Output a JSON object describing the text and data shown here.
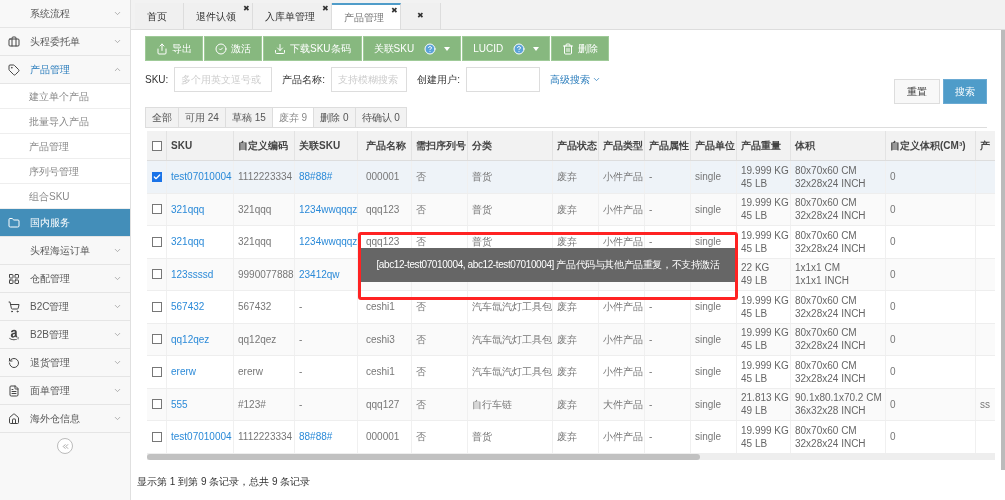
{
  "sidebar": {
    "items": [
      {
        "label": "系统流程",
        "expanded": false,
        "selected": false
      },
      {
        "label": "头程委托单",
        "expanded": false,
        "selected": false
      },
      {
        "label": "产品管理",
        "expanded": true,
        "selected": false,
        "children": [
          {
            "label": "建立单个产品"
          },
          {
            "label": "批量导入产品"
          },
          {
            "label": "产品管理"
          },
          {
            "label": "序列号管理"
          },
          {
            "label": "组合SKU"
          }
        ]
      },
      {
        "label": "国内服务",
        "expanded": false,
        "selected": true
      },
      {
        "label": "头程海运订单",
        "expanded": false,
        "selected": false
      },
      {
        "label": "仓配管理",
        "expanded": false,
        "selected": false
      },
      {
        "label": "B2C管理",
        "expanded": false,
        "selected": false
      },
      {
        "label": "B2B管理",
        "expanded": false,
        "selected": false
      },
      {
        "label": "退货管理",
        "expanded": false,
        "selected": false
      },
      {
        "label": "面单管理",
        "expanded": false,
        "selected": false
      },
      {
        "label": "海外仓信息",
        "expanded": false,
        "selected": false
      }
    ]
  },
  "tabs": [
    {
      "label": "首页",
      "selected": false,
      "closable": false
    },
    {
      "label": "退件认领",
      "selected": false,
      "closable": true
    },
    {
      "label": "入库单管理",
      "selected": false,
      "closable": true
    },
    {
      "label": "产品管理",
      "selected": true,
      "closable": true
    },
    {
      "selected": false,
      "closable": true
    }
  ],
  "close_glyph": "✖",
  "toolbar": [
    {
      "label": "导出",
      "kind": "export",
      "dropdown": false
    },
    {
      "label": "激活",
      "kind": "activate",
      "dropdown": false
    },
    {
      "label": "下载SKU条码",
      "kind": "download",
      "dropdown": false
    },
    {
      "label": "关联SKU",
      "kind": "help",
      "dropdown": true
    },
    {
      "label": "LUCID",
      "kind": "help",
      "dropdown": true
    },
    {
      "label": "删除",
      "kind": "delete",
      "dropdown": false
    }
  ],
  "filters": [
    {
      "label": "SKU:",
      "placeholder": "多个用英文逗号或"
    },
    {
      "label": "产品名称:",
      "placeholder": "支持模糊搜索"
    },
    {
      "label": "创建用户:"
    }
  ],
  "advanced_search": "高级搜索",
  "reset_button": "重置",
  "search_button": "搜索",
  "status_tabs": [
    {
      "label": "全部",
      "selected": false
    },
    {
      "label": "可用 24",
      "selected": false
    },
    {
      "label": "草稿 15",
      "selected": false
    },
    {
      "label": "废弃 9",
      "selected": true
    },
    {
      "label": "删除 0",
      "selected": false
    },
    {
      "label": "待确认 0",
      "selected": false
    }
  ],
  "table": {
    "all_selected": false,
    "columns": [
      {
        "label": "SKU",
        "kind": "link"
      },
      {
        "label": "自定义编码",
        "kind": "text"
      },
      {
        "label": "关联SKU",
        "kind": "link"
      },
      {
        "label": "产品名称",
        "kind": "text"
      },
      {
        "label": "需扫序列号",
        "kind": "text"
      },
      {
        "label": "分类",
        "kind": "text"
      },
      {
        "label": "产品状态",
        "kind": "text"
      },
      {
        "label": "产品类型",
        "kind": "text"
      },
      {
        "label": "产品属性",
        "kind": "text"
      },
      {
        "label": "产品单位",
        "kind": "text"
      },
      {
        "label": "产品重量",
        "kind": "multi"
      },
      {
        "label": "体积",
        "kind": "multi"
      },
      {
        "label": "自定义体积(CM³)",
        "kind": "text"
      },
      {
        "label": "产",
        "kind": "text"
      }
    ],
    "rows": [
      {
        "selected": true,
        "cells": [
          "test07010004",
          "1112223334",
          "88#88#",
          "000001",
          "否",
          "普货",
          "废弃",
          "小件产品",
          "-",
          "single",
          [
            "19.999 KG",
            "45 LB"
          ],
          [
            "80x70x60 CM",
            "32x28x24 INCH"
          ],
          "0",
          null
        ]
      },
      {
        "selected": false,
        "cells": [
          "321qqq",
          "321qqq",
          "1234wwqqqz",
          "qqq123",
          "否",
          "普货",
          "废弃",
          "小件产品",
          "-",
          "single",
          [
            "19.999 KG",
            "45 LB"
          ],
          [
            "80x70x60 CM",
            "32x28x24 INCH"
          ],
          "0",
          null
        ]
      },
      {
        "selected": false,
        "cells": [
          "321qqq",
          "321qqq",
          "1234wwqqqz",
          "qqq123",
          "否",
          "普货",
          "废弃",
          "小件产品",
          "-",
          "single",
          [
            "19.999 KG",
            "45 LB"
          ],
          [
            "80x70x60 CM",
            "32x28x24 INCH"
          ],
          "0",
          null
        ]
      },
      {
        "selected": false,
        "cells": [
          "123ssssd",
          "9990077888",
          "23412qw",
          null,
          null,
          null,
          null,
          null,
          null,
          null,
          [
            "22 KG",
            "49 LB"
          ],
          [
            "1x1x1 CM",
            "1x1x1 INCH"
          ],
          "0",
          null
        ]
      },
      {
        "selected": false,
        "cells": [
          "567432",
          "567432",
          "-",
          "ceshi1",
          "否",
          "汽车氙汽灯工具包",
          "废弃",
          "小件产品",
          "-",
          "single",
          [
            "19.999 KG",
            "45 LB"
          ],
          [
            "80x70x60 CM",
            "32x28x24 INCH"
          ],
          "0",
          null
        ]
      },
      {
        "selected": false,
        "cells": [
          "qq12qez",
          "qq12qez",
          "-",
          "ceshi3",
          "否",
          "汽车氙汽灯工具包",
          "废弃",
          "小件产品",
          "-",
          "single",
          [
            "19.999 KG",
            "45 LB"
          ],
          [
            "80x70x60 CM",
            "32x28x24 INCH"
          ],
          "0",
          null
        ]
      },
      {
        "selected": false,
        "cells": [
          "ererw",
          "ererw",
          "-",
          "ceshi1",
          "否",
          "汽车氙汽灯工具包",
          "废弃",
          "小件产品",
          "-",
          "single",
          [
            "19.999 KG",
            "45 LB"
          ],
          [
            "80x70x60 CM",
            "32x28x24 INCH"
          ],
          "0",
          null
        ]
      },
      {
        "selected": false,
        "cells": [
          "555",
          "#123#",
          "-",
          "qqq127",
          "否",
          "自行车链",
          "废弃",
          "大件产品",
          "-",
          "single",
          [
            "21.813 KG",
            "49 LB"
          ],
          [
            "90.1x80.1x70.2 CM",
            "36x32x28 INCH"
          ],
          "0",
          "ss"
        ]
      },
      {
        "selected": false,
        "cells": [
          "test07010004",
          "1112223334",
          "88#88#",
          "000001",
          "否",
          "普货",
          "废弃",
          "小件产品",
          "-",
          "single",
          [
            "19.999 KG",
            "45 LB"
          ],
          [
            "80x70x60 CM",
            "32x28x24 INCH"
          ],
          "0",
          null
        ]
      }
    ]
  },
  "toast": "[abc12-test07010004, abc12-test07010004] 产品代码与其他产品重复，不支持激活",
  "pagination_text": "显示第 1 到第 9 条记录，总共 9 条记录"
}
